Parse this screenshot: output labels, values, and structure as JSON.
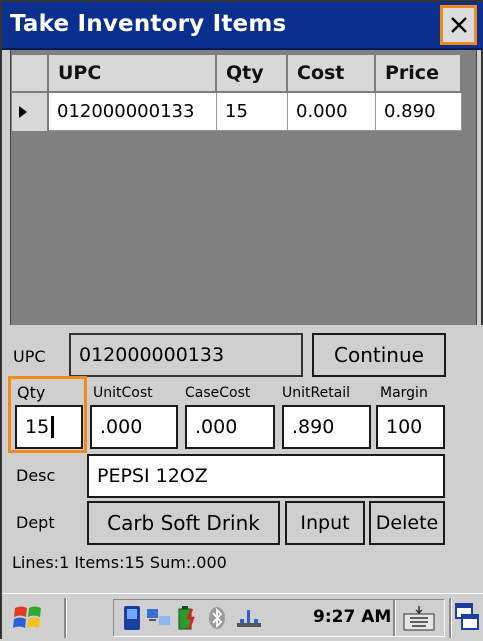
{
  "window": {
    "title": "Take Inventory Items",
    "close_icon": "close-icon"
  },
  "grid": {
    "columns": [
      "UPC",
      "Qty",
      "Cost",
      "Price"
    ],
    "rows": [
      {
        "upc": "012000000133",
        "qty": "15",
        "cost": "0.000",
        "price": "0.890"
      }
    ]
  },
  "form": {
    "upc_label": "UPC",
    "upc_value": "012000000133",
    "continue_label": "Continue",
    "qty_label": "Qty",
    "qty_value": "15",
    "unitcost_label": "UnitCost",
    "unitcost_value": ".000",
    "casecost_label": "CaseCost",
    "casecost_value": ".000",
    "unitretail_label": "UnitRetail",
    "unitretail_value": ".890",
    "margin_label": "Margin",
    "margin_value": "100",
    "desc_label": "Desc",
    "desc_value": "PEPSI 12OZ",
    "dept_label": "Dept",
    "dept_value": "Carb Soft Drink",
    "input_label": "Input",
    "delete_label": "Delete",
    "status_text": "Lines:1 Items:15 Sum:.000"
  },
  "taskbar": {
    "time": "9:27 AM",
    "icons": [
      "windows-start-icon",
      "phone-device-icon",
      "network-icon",
      "battery-icon",
      "bluetooth-icon",
      "connectivity-icon",
      "keyboard-icon",
      "window-switch-icon"
    ]
  },
  "colors": {
    "titlebar": "#0a2f8f",
    "highlight": "#f08a1c",
    "grid_background": "#808080"
  }
}
